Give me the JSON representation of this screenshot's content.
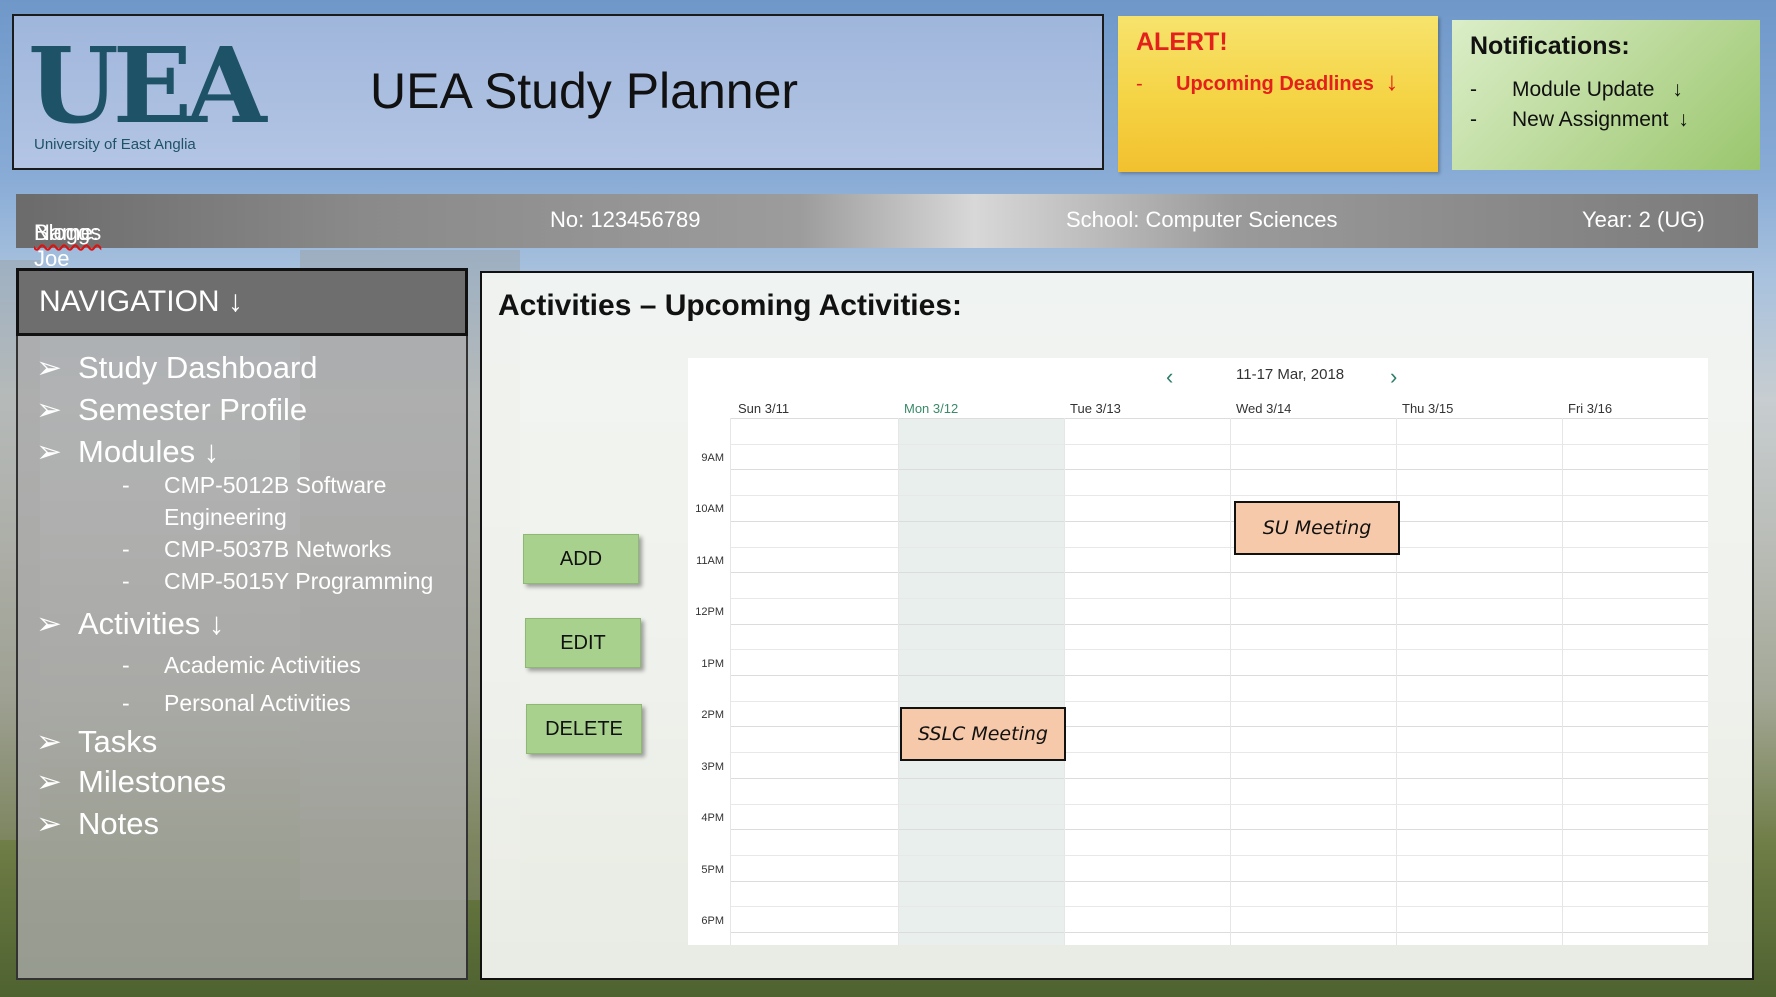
{
  "header": {
    "logo_letters": "UEA",
    "logo_subtitle": "University of East Anglia",
    "title": "UEA Study Planner"
  },
  "alert": {
    "title": "ALERT!",
    "item_dash": "-",
    "item_label": "Upcoming Deadlines",
    "arrow": "↓"
  },
  "notifications": {
    "title": "Notifications:",
    "items": [
      {
        "dash": "-",
        "label": "Module Update",
        "arrow": "↓"
      },
      {
        "dash": "-",
        "label": "New Assignment",
        "arrow": "↓"
      }
    ]
  },
  "student": {
    "name_prefix": "Name: Joe ",
    "name_last": "Bloggs",
    "number": "No: 123456789",
    "school": "School: Computer Sciences",
    "year": "Year: 2 (UG)"
  },
  "navigation": {
    "header": "NAVIGATION ↓",
    "bullet": "➢",
    "items": [
      {
        "label": "Study Dashboard"
      },
      {
        "label": "Semester Profile"
      },
      {
        "label": "Modules ↓",
        "subitems": [
          "CMP-5012B Software",
          "Engineering",
          "CMP-5037B Networks",
          "CMP-5015Y Programming"
        ]
      },
      {
        "label": "Activities ↓",
        "subitems": [
          "Academic Activities",
          "Personal Activities"
        ]
      },
      {
        "label": "Tasks"
      },
      {
        "label": "Milestones"
      },
      {
        "label": "Notes"
      }
    ],
    "sub_dash": "-"
  },
  "main": {
    "title": "Activities – Upcoming Activities:",
    "buttons": {
      "add": "ADD",
      "edit": "EDIT",
      "delete": "DELETE"
    }
  },
  "calendar": {
    "prev": "‹",
    "next": "›",
    "range": "11-17 Mar, 2018",
    "days": [
      "Sun 3/11",
      "Mon 3/12",
      "Tue 3/13",
      "Wed 3/14",
      "Thu 3/15",
      "Fri 3/16"
    ],
    "today": "Mon 3/12",
    "times": [
      "9AM",
      "10AM",
      "11AM",
      "12PM",
      "1PM",
      "2PM",
      "3PM",
      "4PM",
      "5PM",
      "6PM"
    ],
    "events": [
      {
        "title": "SU Meeting",
        "day": "Wed 3/14",
        "start": "10AM"
      },
      {
        "title": "SSLC Meeting",
        "day": "Mon 3/12",
        "start": "2PM"
      }
    ],
    "colors": {
      "event": "#f6c9aa",
      "today": "#e9efec",
      "nav": "#2e7d6b"
    }
  },
  "colors": {
    "button": "#a9d18e",
    "alert_text": "#e3201b",
    "logo": "#1e5266"
  }
}
